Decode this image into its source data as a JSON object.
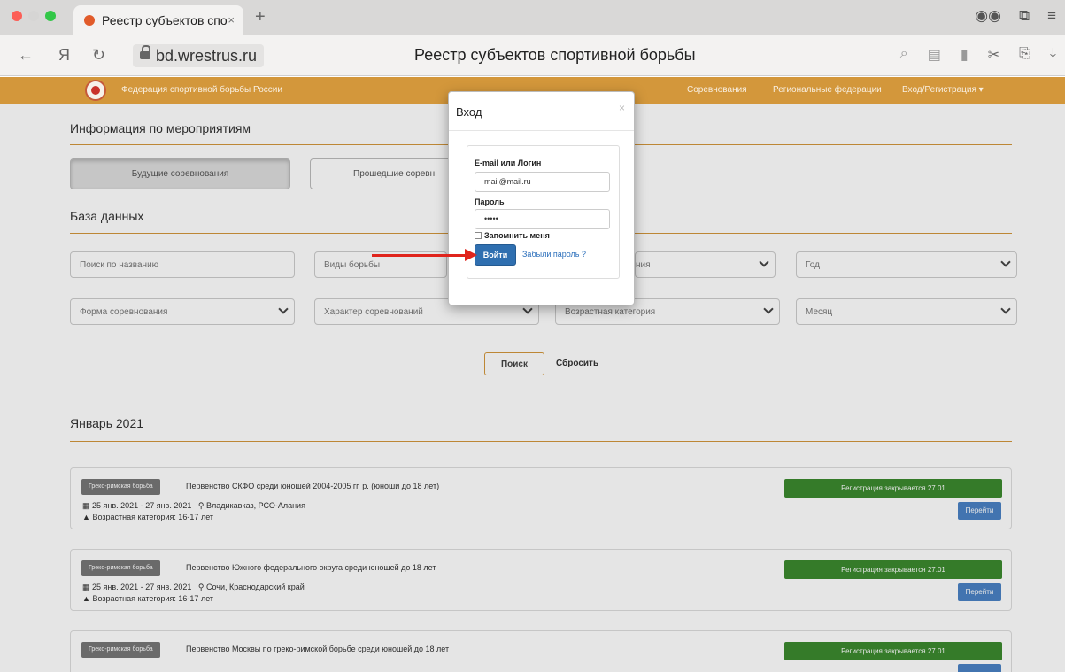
{
  "browser": {
    "tab_title": "Реестр субъектов спо",
    "tab_close": "×",
    "new_tab": "+",
    "back": "←",
    "yandex": "Я",
    "reload": "↻",
    "domain": "bd.wrestrus.ru",
    "page_title": "Реестр субъектов спортивной борьбы"
  },
  "site_nav": {
    "brand": "Федерация спортивной борьбы России",
    "links": [
      "Соревнования",
      "Региональные федерации",
      "Вход/Регистрация ▾"
    ]
  },
  "events_section": {
    "title": "Информация по мероприятиям",
    "tabs": [
      "Будущие соревнования",
      "Прошедшие соревн"
    ]
  },
  "database": {
    "title": "База данных",
    "search_placeholder": "Поиск по названию",
    "filters_row1": [
      "Виды борьбы",
      "ния",
      "Год"
    ],
    "filters_row2": [
      "Форма соревнования",
      "Характер соревнований",
      "Возрастная категория",
      "Месяц"
    ],
    "search_button": "Поиск",
    "reset_link": "Сбросить"
  },
  "month": "Январь 2021",
  "events": [
    {
      "badge": "Греко-римская борьба",
      "title": "Первенство СКФО среди юношей 2004-2005 гг. р. (юноши до 18 лет)",
      "dates": "25 янв. 2021 - 27 янв. 2021",
      "place": "Владикавказ, РСО-Алания",
      "age": "Возрастная категория: 16-17 лет",
      "registration": "Регистрация закрывается 27.01",
      "go": "Перейти"
    },
    {
      "badge": "Греко-римская борьба",
      "title": "Первенство Южного федерального округа среди юношей до 18 лет",
      "dates": "25 янв. 2021 - 27 янв. 2021",
      "place": "Сочи, Краснодарский край",
      "age": "Возрастная категория: 16-17 лет",
      "registration": "Регистрация закрывается 27.01",
      "go": "Перейти"
    },
    {
      "badge": "Греко-римская борьба",
      "title": "Первенство Москвы по греко-римской борьбе среди юношей до 18 лет",
      "registration": "Регистрация закрывается 27.01"
    }
  ],
  "modal": {
    "title": "Вход",
    "close": "×",
    "email_label": "E-mail или Логин",
    "email_value": "mail@mail.ru",
    "password_label": "Пароль",
    "password_value": "•••••",
    "remember_label": "Запомнить меня",
    "login_button": "Войти",
    "forgot_link": "Забыли пароль ?"
  },
  "colors": {
    "nav_brand": "#d3973b",
    "registration_green": "#3b8a2e",
    "button_blue": "#2f6fb0",
    "annotation_red": "#e0241c"
  }
}
